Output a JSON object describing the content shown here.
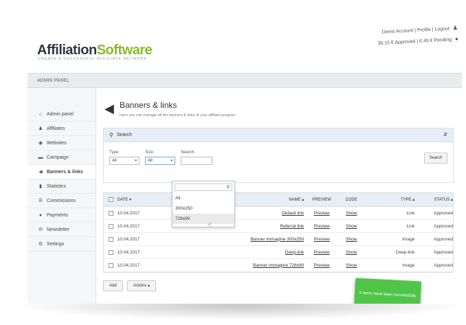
{
  "header": {
    "logo_part1": "Affiliation",
    "logo_part2": "Software",
    "tagline": "CREATE A SUCCESSFUL AFFILIATE NETWORK",
    "account_links": [
      "Demo Account",
      "Profile",
      "Logout"
    ],
    "balance_text": "36.15 € Approved | 6.49 € Pending"
  },
  "adminbar": {
    "label": "ADMIN PANEL"
  },
  "sidebar": {
    "items": [
      {
        "label": "Admin panel",
        "icon": "home-icon"
      },
      {
        "label": "Affiliates",
        "icon": "users-icon"
      },
      {
        "label": "Websites",
        "icon": "globe-icon"
      },
      {
        "label": "Campaign",
        "icon": "folder-icon"
      },
      {
        "label": "Banners & links",
        "icon": "megaphone-icon",
        "active": true
      },
      {
        "label": "Statistics",
        "icon": "chart-icon"
      },
      {
        "label": "Commissions",
        "icon": "list-icon"
      },
      {
        "label": "Payments",
        "icon": "coins-icon"
      },
      {
        "label": "Newsletter",
        "icon": "envelope-icon"
      },
      {
        "label": "Settings",
        "icon": "gear-icon"
      }
    ]
  },
  "page": {
    "title": "Banners & links",
    "subtitle": "Here you can manage all the banners & links of your affiliate program"
  },
  "search": {
    "title": "Search",
    "type_label": "Type:",
    "type_value": "All",
    "size_label": "Size:",
    "size_value": "All",
    "text_label": "Search:",
    "button": "Search",
    "size_options": [
      "All",
      "300x250",
      "728x90"
    ]
  },
  "table": {
    "headers": {
      "date": "DATE",
      "name": "NAME",
      "preview": "PREVIEW",
      "code": "CODE",
      "type": "TYPE",
      "status": "STATUS"
    },
    "rows": [
      {
        "date": "10.04.2017",
        "name": "Default link",
        "preview": "Preview",
        "code": "Show",
        "type": "Link",
        "status": "Approved"
      },
      {
        "date": "10.04.2017",
        "name": "Referral link",
        "preview": "Preview",
        "code": "Show",
        "type": "Link",
        "status": "Approved"
      },
      {
        "date": "10.04.2017",
        "name": "Banner immagine 300x250",
        "preview": "Preview",
        "code": "Show",
        "type": "Image",
        "status": "Approved"
      },
      {
        "date": "10.04.2017",
        "name": "Deep-link",
        "preview": "Preview",
        "code": "Show",
        "type": "Deep-link",
        "status": "Approved"
      },
      {
        "date": "10.04.2017",
        "name": "Banner immagine 728x90",
        "preview": "Preview",
        "code": "Show",
        "type": "Image",
        "status": "Approved"
      }
    ],
    "add_button": "Add",
    "actions_button": "Actions"
  },
  "toast": {
    "message": "2 items have been successfully saved"
  }
}
